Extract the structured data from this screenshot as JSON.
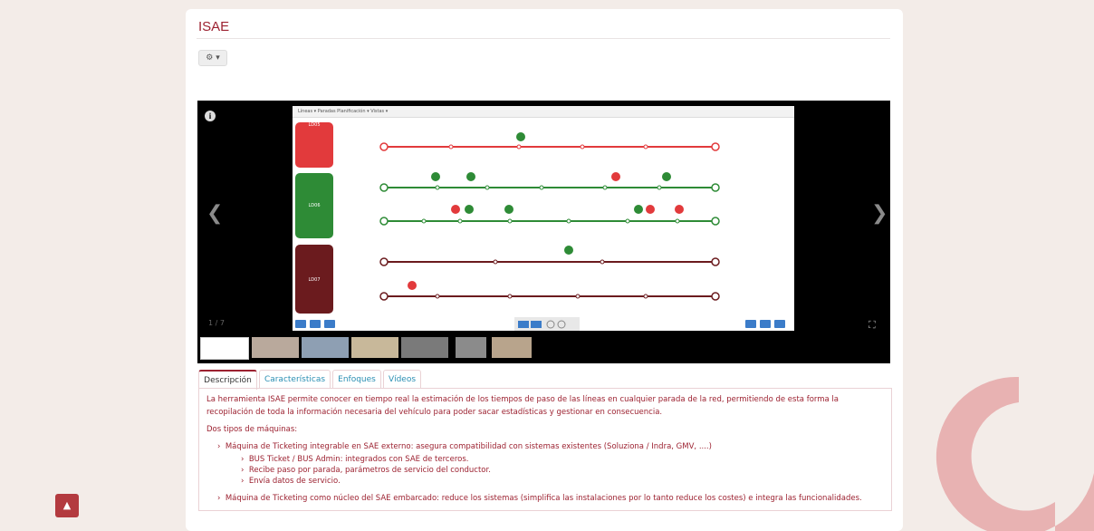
{
  "page": {
    "title": "ISAE"
  },
  "toolbar": {
    "gear_label": "⚙ ▾"
  },
  "gallery": {
    "info_icon": "info-icon",
    "prev_icon": "chevron-left-icon",
    "next_icon": "chevron-right-icon",
    "counter": "1 / 7",
    "fullscreen_icon": "fullscreen-icon",
    "screenshot_menu": "Líneas ▾   Paradas   Planificación ▾   Vistas ▾",
    "lines": [
      {
        "label": "LD05",
        "color": "#e23a3c"
      },
      {
        "label": "LD06",
        "color": "#2e8b36"
      },
      {
        "label": "LD07",
        "color": "#6b1b1e"
      }
    ],
    "thumbnail_count": 7
  },
  "tabs": [
    {
      "label": "Descripción",
      "active": true
    },
    {
      "label": "Características",
      "active": false
    },
    {
      "label": "Enfoques",
      "active": false
    },
    {
      "label": "Vídeos",
      "active": false
    }
  ],
  "description": {
    "para1_line1": "La herramienta ISAE permite conocer en tiempo real la estimación de los tiempos de paso de las líneas en cualquier parada de la red, permitiendo de esta forma la",
    "para1_line2": "recopilación de toda la información necesaria del vehículo para poder sacar estadísticas y gestionar en consecuencia.",
    "intro": "Dos tipos de máquinas:",
    "item1": "Máquina de Ticketing integrable en SAE externo: asegura compatibilidad con sistemas existentes (Soluziona / Indra, GMV, ....)",
    "sub1": "BUS Ticket / BUS Admin: integrados con SAE de terceros.",
    "sub2": "Recibe paso por parada, parámetros de servicio del conductor.",
    "sub3": "Envía datos de servicio.",
    "item2": "Máquina de Ticketing como núcleo del SAE embarcado: reduce los sistemas (simplifica las instalaciones por lo tanto reduce los costes) e integra las funcionalidades."
  },
  "colors": {
    "brand": "#9c2130",
    "tab_link": "#2a8fb3",
    "background": "#f3ece8"
  }
}
